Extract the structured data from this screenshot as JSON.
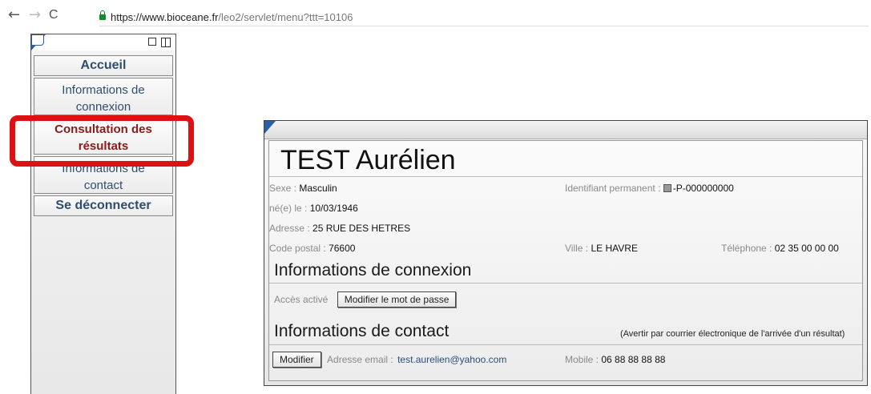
{
  "browser": {
    "back": "←",
    "forward": "→",
    "reload": "C",
    "url_host": "https://www.bioceane.fr",
    "url_path": "/leo2/servlet/menu?ttt=10106"
  },
  "sidebar": {
    "items": [
      {
        "label": "Accueil"
      },
      {
        "label": "Informations de connexion"
      },
      {
        "label": "Consultation des résultats"
      },
      {
        "label": "Informations de contact"
      },
      {
        "label": "Se déconnecter"
      }
    ]
  },
  "patient": {
    "name": "TEST Aurélien",
    "sexe_label": "Sexe :",
    "sexe_value": "Masculin",
    "id_label": "Identifiant permanent :",
    "id_value": "-P-000000000",
    "dob_label": "né(e) le :",
    "dob_value": "10/03/1946",
    "adresse_label": "Adresse :",
    "adresse_value": "25 RUE DES HETRES",
    "cp_label": "Code postal :",
    "cp_value": "76600",
    "ville_label": "Ville :",
    "ville_value": "LE HAVRE",
    "tel_label": "Téléphone :",
    "tel_value": "02 35 00 00 00"
  },
  "connexion": {
    "title": "Informations de connexion",
    "acces": "Accès activé",
    "modify_password": "Modifier le mot de passe"
  },
  "contact": {
    "title": "Informations de contact",
    "notify": "(Avertir par courrier électronique de l'arrivée d'un résultat)",
    "modify": "Modifier",
    "email_label": "Adresse email :",
    "email_value": "test.aurelien@yahoo.com",
    "mobile_label": "Mobile :",
    "mobile_value": "06 88 88 88 88"
  }
}
